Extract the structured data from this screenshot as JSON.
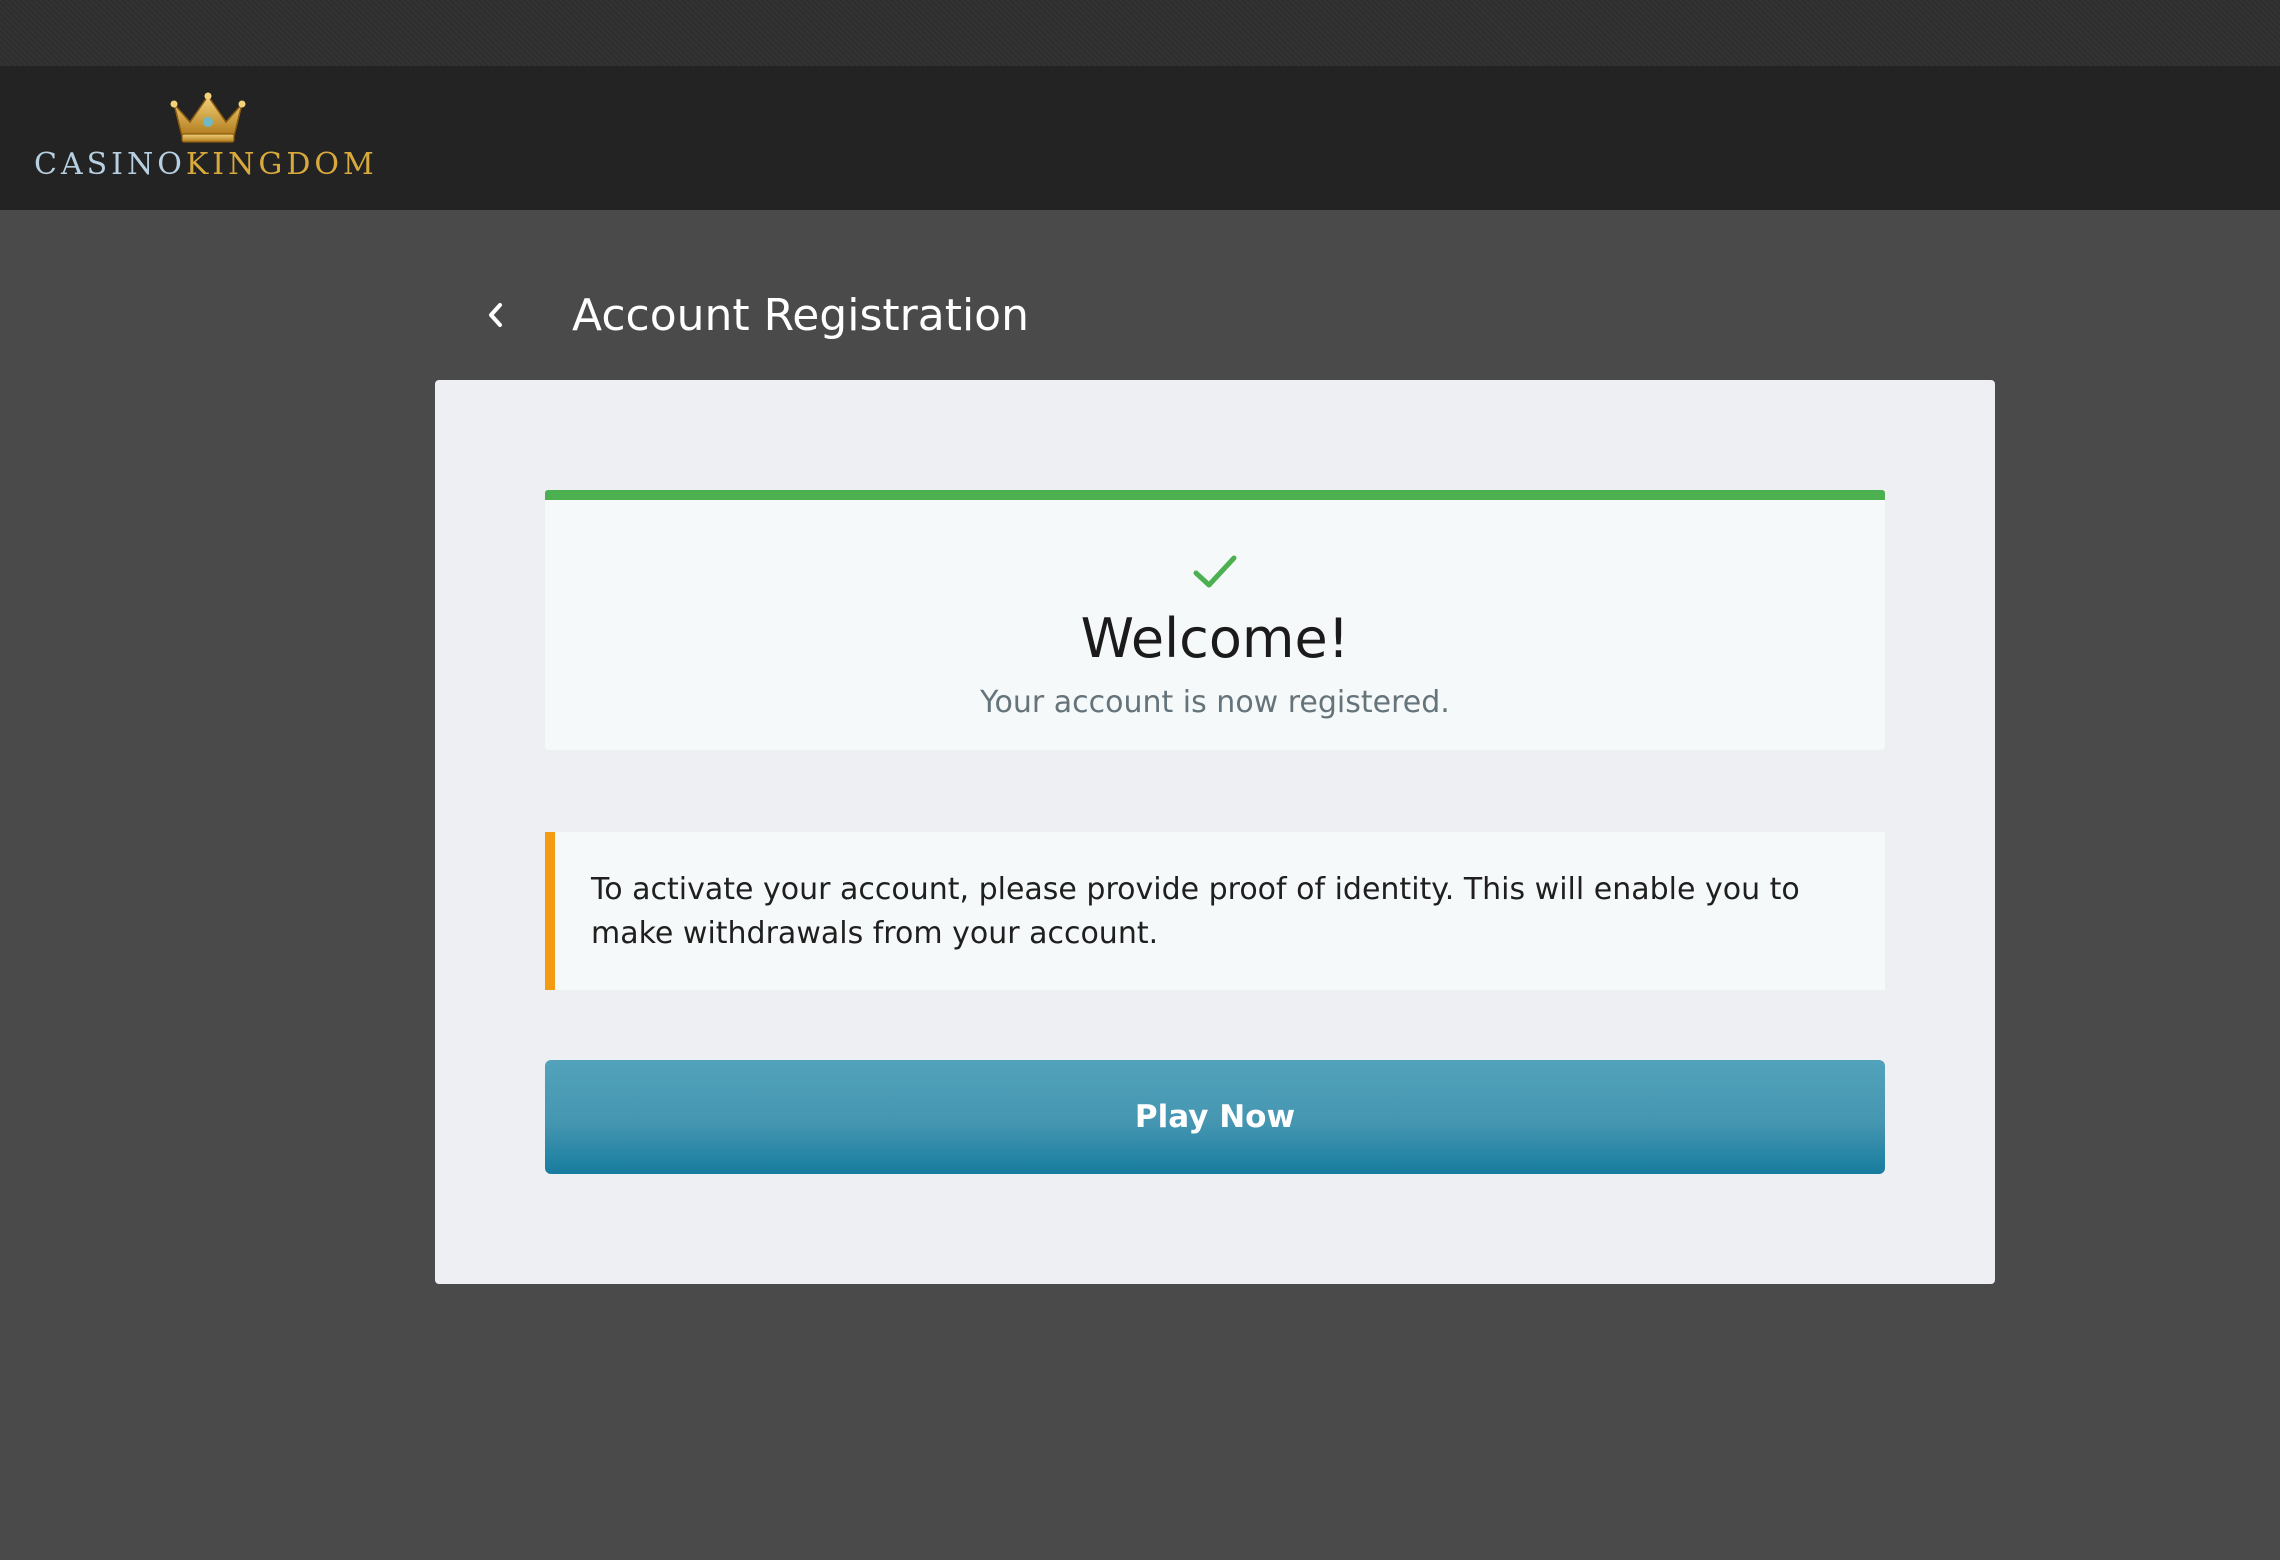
{
  "header": {
    "logo": {
      "word1": "CASINO",
      "word2": "KINGDOM",
      "crown_icon": "crown-icon",
      "colors": {
        "word1": "#b7cfe0",
        "word2": "#d9a93c"
      }
    }
  },
  "page": {
    "back_icon": "chevron-left-icon",
    "title": "Account Registration"
  },
  "success": {
    "icon": "check-icon",
    "title": "Welcome!",
    "message": "Your account is now registered.",
    "accent_color": "#4caf50"
  },
  "notice": {
    "text": "To activate your account, please provide proof of identity. This will enable you to make withdrawals from your account.",
    "accent_color": "#f39c12"
  },
  "actions": {
    "play_label": "Play Now",
    "button_color": "#4596b1"
  }
}
